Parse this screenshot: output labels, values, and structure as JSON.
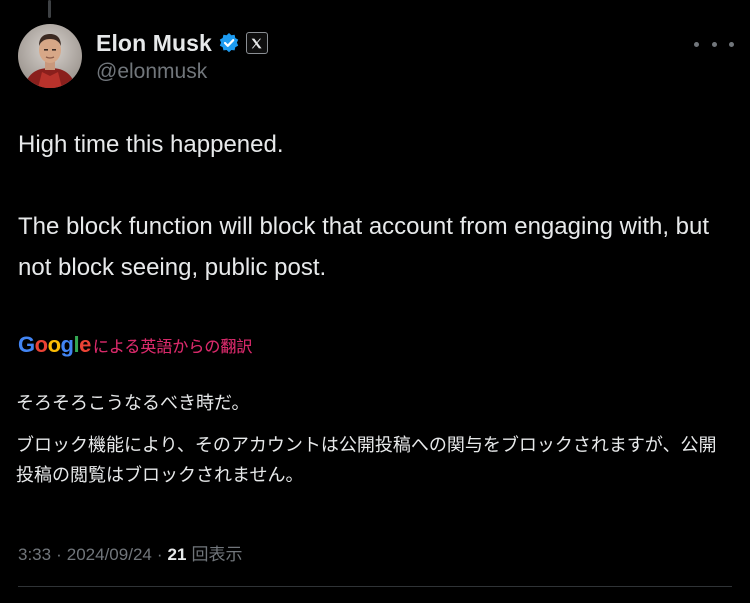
{
  "author": {
    "display_name": "Elon Musk",
    "handle": "@elonmusk",
    "verified": true,
    "affiliate_badge": "x-logo-icon"
  },
  "tweet": {
    "paragraphs": [
      "High time this happened.",
      "The block function will block that account from engaging with, but not block seeing, public post."
    ]
  },
  "translation": {
    "provider": "Google",
    "label": "による英語からの翻訳",
    "paragraphs": [
      "そろそろこうなるべき時だ。",
      "ブロック機能により、そのアカウントは公開投稿への関与をブロックされますが、公開投稿の閲覧はブロックされません。"
    ]
  },
  "meta": {
    "time": "3:33",
    "date": "2024/09/24",
    "views_count": "21",
    "views_label": "回表示",
    "separator": "·"
  },
  "colors": {
    "background": "#000000",
    "text_primary": "#e7e9ea",
    "text_secondary": "#71767b",
    "verified_blue": "#1d9bf0",
    "translate_pink": "#d62a6a"
  },
  "icons": {
    "more": "more-horizontal-icon",
    "verified": "verified-badge-icon"
  }
}
